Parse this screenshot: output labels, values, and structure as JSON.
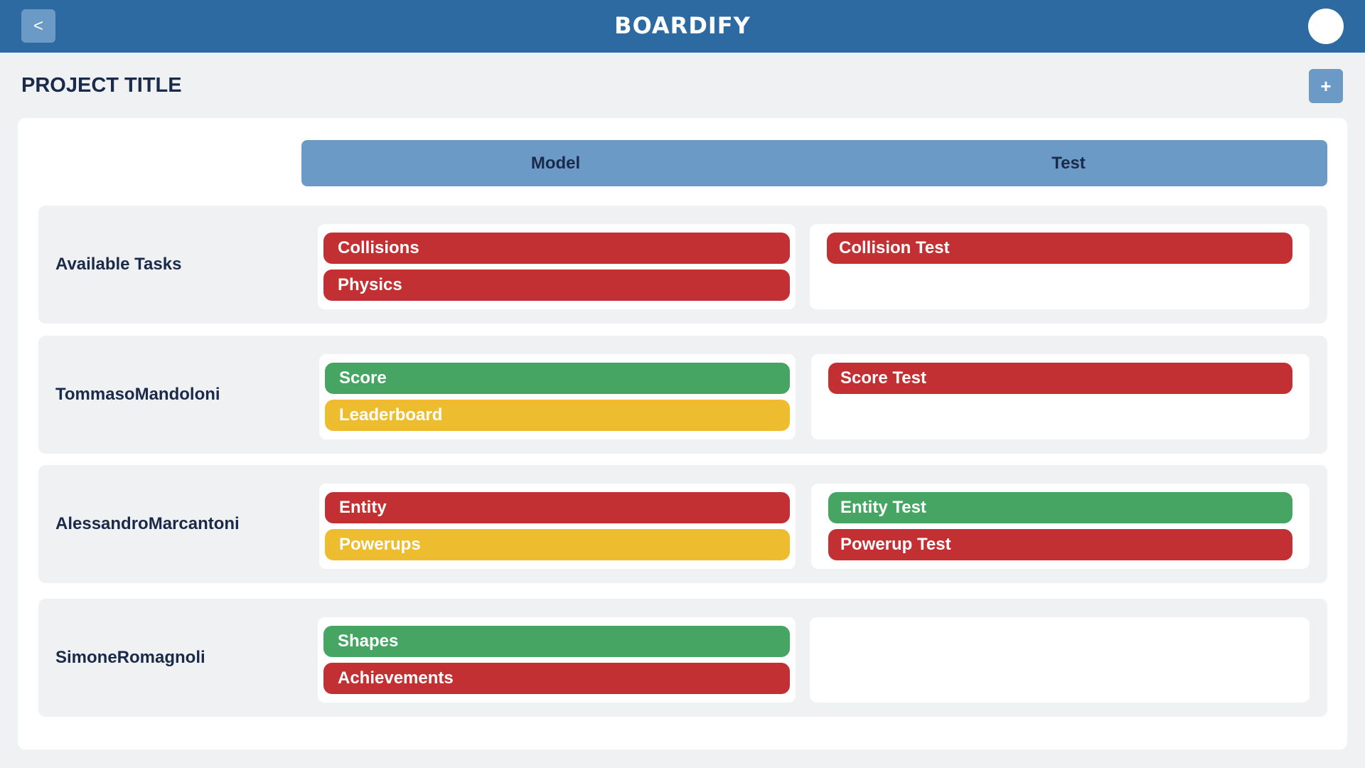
{
  "header": {
    "back_label": "<",
    "app_title": "BOARDIFY"
  },
  "project": {
    "title": "PROJECT TITLE",
    "add_label": "+"
  },
  "columns": [
    "Model",
    "Test"
  ],
  "colors": {
    "red": "#c33033",
    "green": "#46a563",
    "yellow": "#eebc2f",
    "accent": "#2e6aa2"
  },
  "rows": [
    {
      "name": "Available Tasks",
      "model": [
        {
          "label": "Collisions",
          "status": "red"
        },
        {
          "label": "Physics",
          "status": "red"
        }
      ],
      "test": [
        {
          "label": "Collision Test",
          "status": "red"
        }
      ]
    },
    {
      "name": "TommasoMandoloni",
      "model": [
        {
          "label": "Score",
          "status": "green"
        },
        {
          "label": "Leaderboard",
          "status": "yellow"
        }
      ],
      "test": [
        {
          "label": "Score Test",
          "status": "red"
        }
      ]
    },
    {
      "name": "AlessandroMarcantoni",
      "model": [
        {
          "label": "Entity",
          "status": "red"
        },
        {
          "label": "Powerups",
          "status": "yellow"
        }
      ],
      "test": [
        {
          "label": "Entity Test",
          "status": "green"
        },
        {
          "label": "Powerup Test",
          "status": "red"
        }
      ]
    },
    {
      "name": "SimoneRomagnoli",
      "model": [
        {
          "label": "Shapes",
          "status": "green"
        },
        {
          "label": "Achievements",
          "status": "red"
        }
      ],
      "test": []
    }
  ]
}
